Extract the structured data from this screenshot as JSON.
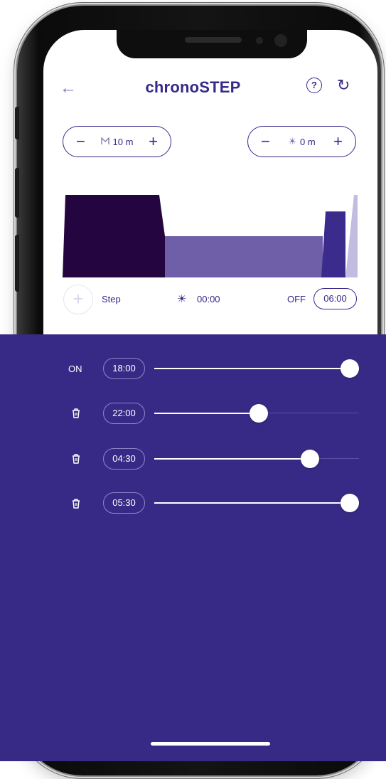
{
  "app": {
    "title": "chronoSTEP",
    "back_icon": "arrow-left-icon",
    "help_icon": "question-circle-icon",
    "reset_icon": "refresh-icon",
    "help_glyph": "?"
  },
  "steppers": {
    "left": {
      "minus": "−",
      "plus": "+",
      "icon": "moon-icon",
      "value": "10 m"
    },
    "right": {
      "minus": "−",
      "plus": "+",
      "icon": "sun-icon",
      "value": "0 m"
    }
  },
  "chart_data": {
    "type": "area",
    "title": "",
    "xlabel": "",
    "ylabel": "",
    "segments": [
      {
        "level": 1.0,
        "color": "#25053f"
      },
      {
        "level": 0.5,
        "color": "#6f5fa8"
      },
      {
        "level": 0.8,
        "color": "#3a2b8c"
      },
      {
        "level": 1.0,
        "color": "#c2bde0"
      }
    ]
  },
  "step_row": {
    "add_glyph": "+",
    "step_label": "Step",
    "sun_time": "00:00",
    "off_label": "OFF",
    "off_time": "06:00"
  },
  "schedule": {
    "rows": [
      {
        "label": "ON",
        "icon": "",
        "time": "18:00",
        "level": 1.0
      },
      {
        "label": "",
        "icon": "trash-icon",
        "time": "22:00",
        "level": 0.51
      },
      {
        "label": "",
        "icon": "trash-icon",
        "time": "04:30",
        "level": 0.76
      },
      {
        "label": "",
        "icon": "trash-icon",
        "time": "05:30",
        "level": 1.0
      }
    ]
  },
  "colors": {
    "brand": "#35298a",
    "panel": "#372a86",
    "dark_block": "#25053f",
    "mid_block": "#6f5fa8",
    "light_block": "#c2bde0"
  }
}
